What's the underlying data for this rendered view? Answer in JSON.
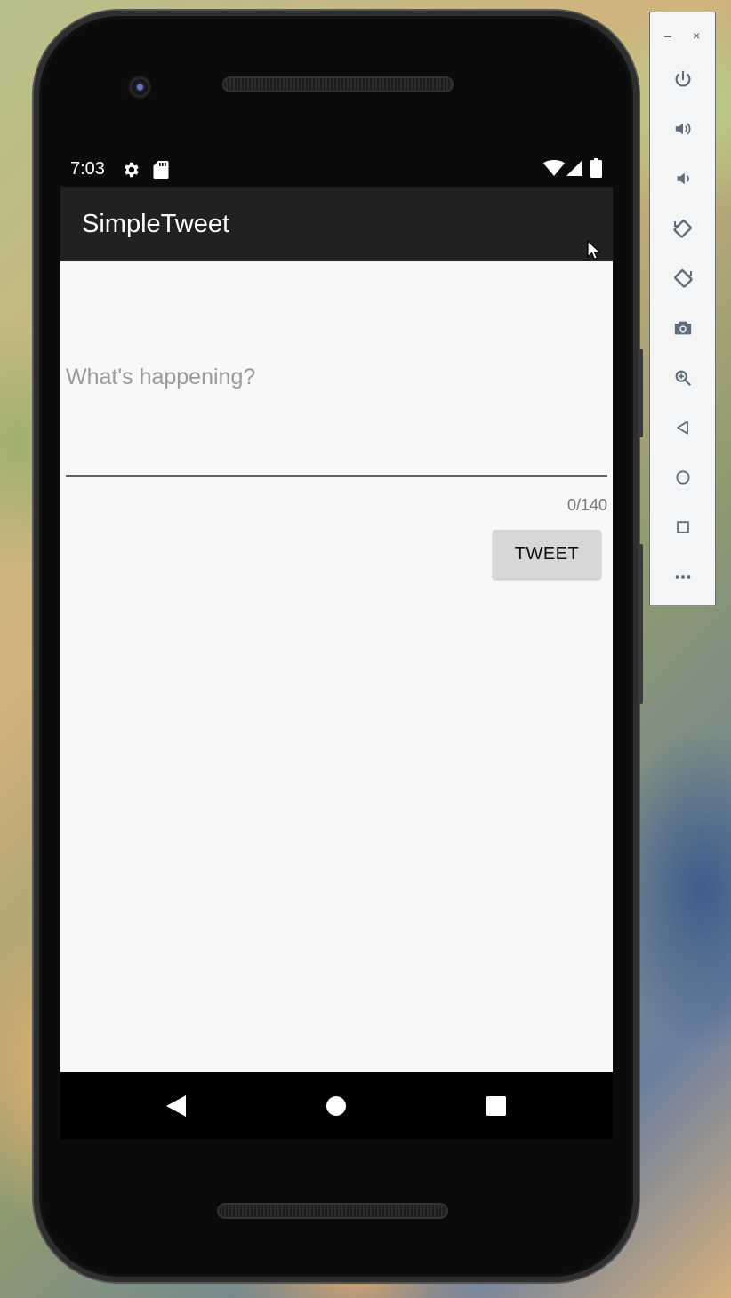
{
  "status_bar": {
    "time": "7:03",
    "left_icons": [
      "gear-icon",
      "sd-card-icon"
    ],
    "right_icons": [
      "wifi-icon",
      "cell-signal-icon",
      "battery-icon"
    ]
  },
  "app_bar": {
    "title": "SimpleTweet"
  },
  "compose": {
    "input_value": "",
    "input_placeholder": "What's happening?",
    "char_count": "0/140",
    "tweet_button_label": "TWEET"
  },
  "nav_bar": {
    "icons": [
      "back-icon",
      "home-icon",
      "recents-icon"
    ]
  },
  "emulator_toolbar": {
    "window_controls": [
      "–",
      "×"
    ],
    "icons": [
      "power-icon",
      "volume-up-icon",
      "volume-down-icon",
      "rotate-left-icon",
      "rotate-right-icon",
      "camera-icon",
      "zoom-icon",
      "back-icon",
      "home-icon",
      "overview-icon",
      "more-icon"
    ]
  },
  "colors": {
    "app_bar": "#212121",
    "content_background": "#f7f8f8",
    "button": "#d6d7d7",
    "toolbar_icon": "#5f6d7a"
  }
}
